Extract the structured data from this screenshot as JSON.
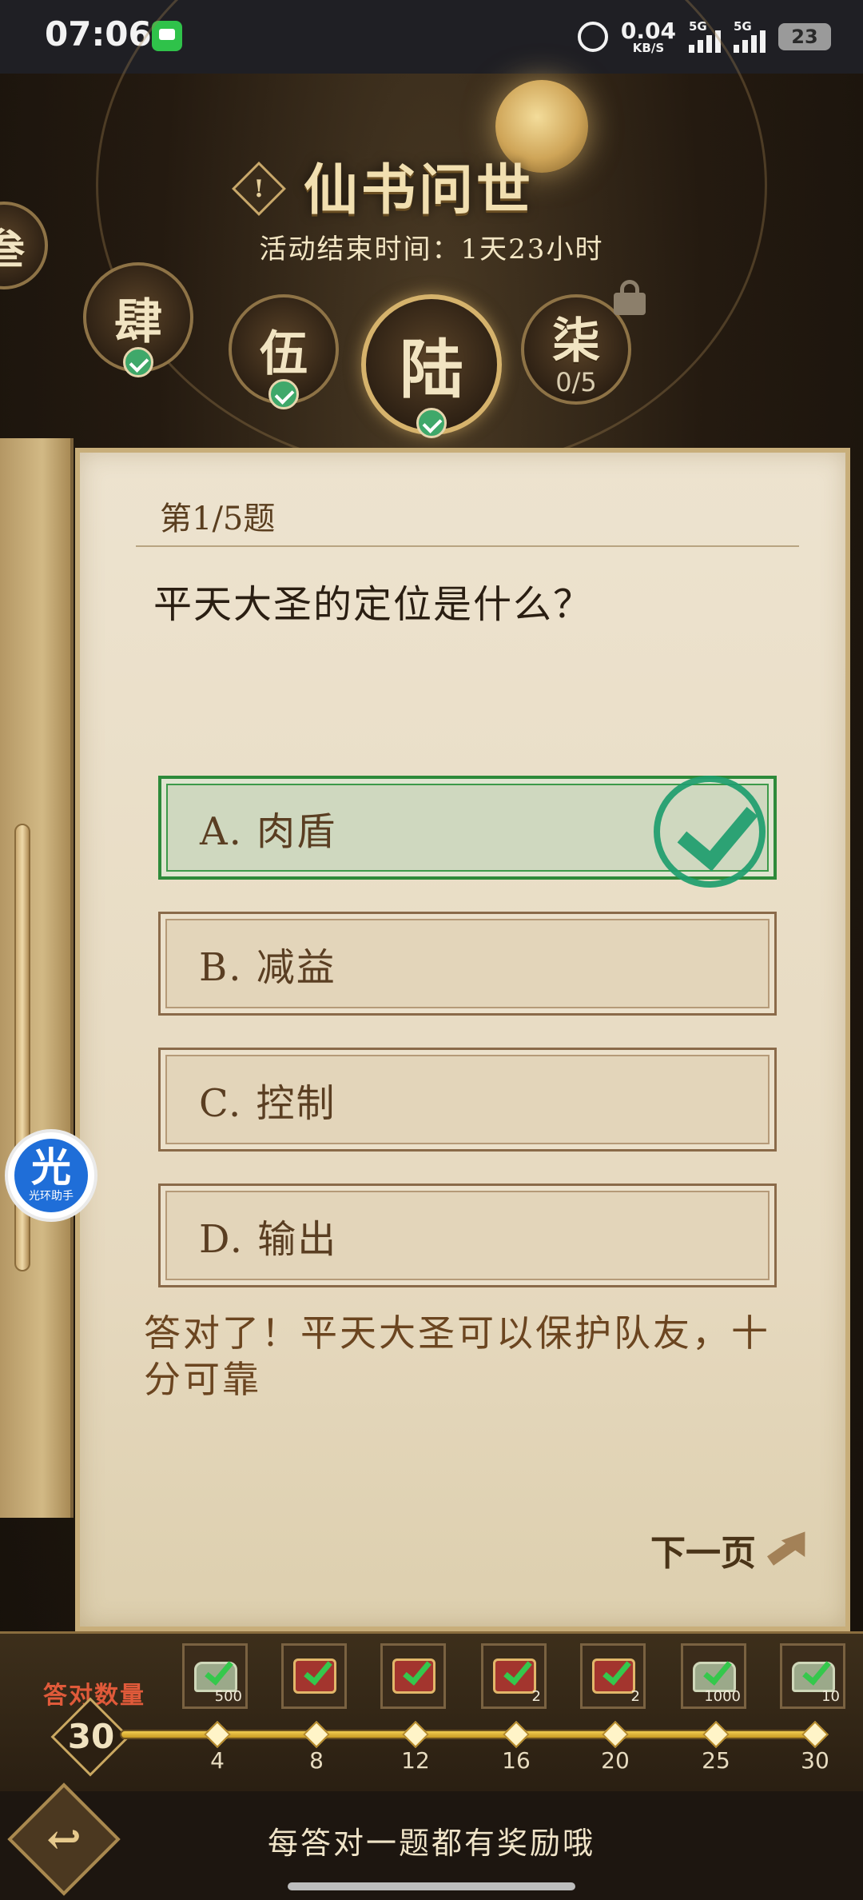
{
  "status_bar": {
    "time": "07:06",
    "net_speed": "0.04",
    "net_unit": "KB/S",
    "sig1_label": "5G",
    "sig2_label": "5G",
    "battery": "23"
  },
  "header": {
    "title": "仙书问世",
    "end_time": "活动结束时间：1天23小时",
    "alert_glyph": "!"
  },
  "chapters": [
    {
      "label": "叁",
      "state": "done"
    },
    {
      "label": "肆",
      "state": "done"
    },
    {
      "label": "伍",
      "state": "done"
    },
    {
      "label": "陆",
      "state": "current"
    },
    {
      "label": "柒",
      "state": "locked",
      "progress": "0/5"
    }
  ],
  "quiz": {
    "question_number": "第1/5题",
    "question": "平天大圣的定位是什么？",
    "options": [
      {
        "label": "A. 肉盾",
        "state": "correct"
      },
      {
        "label": "B. 减益",
        "state": "normal"
      },
      {
        "label": "C. 控制",
        "state": "normal"
      },
      {
        "label": "D. 输出",
        "state": "normal"
      }
    ],
    "feedback": "答对了！平天大圣可以保护队友，十分可靠",
    "next_label": "下一页"
  },
  "helper": {
    "big": "光",
    "small": "光环助手"
  },
  "rewards": {
    "label": "答对数量",
    "count": "30",
    "milestones": [
      "4",
      "8",
      "12",
      "16",
      "20",
      "25",
      "30"
    ],
    "items": [
      {
        "type": "jade",
        "qty": "500"
      },
      {
        "type": "chest",
        "qty": ""
      },
      {
        "type": "chest",
        "qty": ""
      },
      {
        "type": "chest",
        "qty": "2"
      },
      {
        "type": "chest",
        "qty": "2"
      },
      {
        "type": "jade",
        "qty": "1000"
      },
      {
        "type": "jade",
        "qty": "10"
      }
    ]
  },
  "footer": {
    "text": "每答对一题都有奖励哦",
    "back_glyph": "↩"
  }
}
